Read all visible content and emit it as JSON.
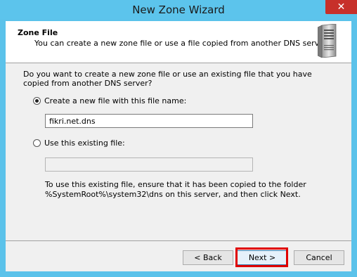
{
  "window": {
    "title": "New Zone Wizard",
    "close_glyph": "✕"
  },
  "header": {
    "title": "Zone File",
    "subtitle": "You can create a new zone file or use a file copied from another DNS server.",
    "icon": "server-icon"
  },
  "body": {
    "question": "Do you want to create a new zone file or use an existing file that you have copied from another DNS server?",
    "create_option": {
      "label": "Create a new file with this file name:",
      "checked": true,
      "value": "fikri.net.dns"
    },
    "existing_option": {
      "label": "Use this existing file:",
      "checked": false,
      "value": ""
    },
    "note": "To use this existing file, ensure that it has been copied to the folder %SystemRoot%\\system32\\dns on this server, and then click Next."
  },
  "buttons": {
    "back": "< Back",
    "next": "Next >",
    "cancel": "Cancel"
  },
  "colors": {
    "titlebar": "#5cc4ec",
    "close": "#c7302a",
    "highlight": "#e00000"
  }
}
